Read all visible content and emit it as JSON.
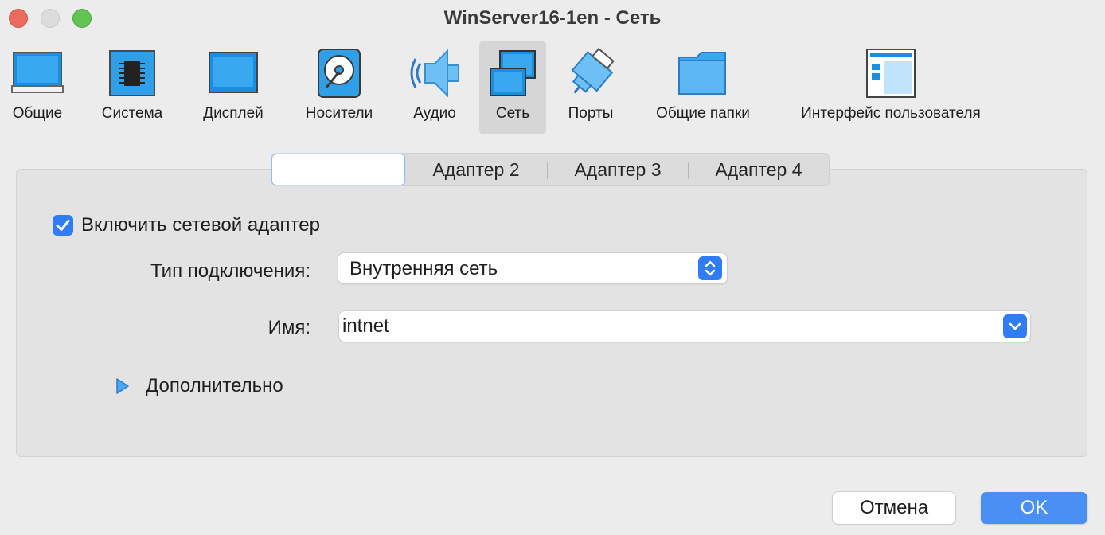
{
  "window": {
    "title": "WinServer16-1en - Сеть"
  },
  "toolbar": {
    "items": [
      {
        "label": "Общие",
        "icon": "general-monitor-icon"
      },
      {
        "label": "Система",
        "icon": "chip-icon"
      },
      {
        "label": "Дисплей",
        "icon": "display-icon"
      },
      {
        "label": "Носители",
        "icon": "disk-icon"
      },
      {
        "label": "Аудио",
        "icon": "speaker-icon"
      },
      {
        "label": "Сеть",
        "icon": "network-icon",
        "selected": true
      },
      {
        "label": "Порты",
        "icon": "port-icon"
      },
      {
        "label": "Общие папки",
        "icon": "folder-icon"
      },
      {
        "label": "Интерфейс пользователя",
        "icon": "user-interface-icon"
      }
    ]
  },
  "tabs": {
    "items": [
      {
        "label": "",
        "active": true
      },
      {
        "label": "Адаптер 2"
      },
      {
        "label": "Адаптер 3"
      },
      {
        "label": "Адаптер 4"
      }
    ]
  },
  "adapter": {
    "enable_label": "Включить сетевой адаптер",
    "enabled": true,
    "attached_label": "Тип подключения:",
    "attached_value": "Внутренняя сеть",
    "name_label": "Имя:",
    "name_value": "intnet",
    "advanced_label": "Дополнительно"
  },
  "buttons": {
    "cancel": "Отмена",
    "ok": "OK"
  },
  "colors": {
    "accent": "#2f7cf6",
    "ok_button": "#4a90f4",
    "icon_blue": "#1a8fe0"
  }
}
